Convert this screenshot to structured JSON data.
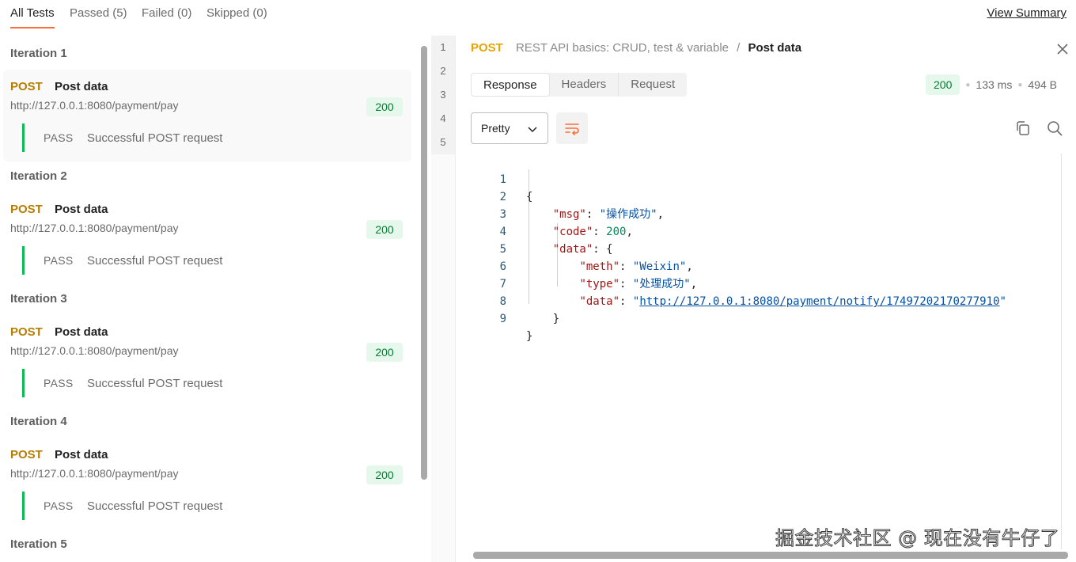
{
  "top_tabs": [
    {
      "label": "All Tests"
    },
    {
      "label": "Passed (5)"
    },
    {
      "label": "Failed (0)"
    },
    {
      "label": "Skipped (0)"
    }
  ],
  "view_summary": "View Summary",
  "iterations": [
    {
      "title": "Iteration 1",
      "method": "POST",
      "name": "Post data",
      "url": "http://127.0.0.1:8080/payment/pay",
      "status": "200",
      "test_result": "PASS",
      "test_name": "Successful POST request"
    },
    {
      "title": "Iteration 2",
      "method": "POST",
      "name": "Post data",
      "url": "http://127.0.0.1:8080/payment/pay",
      "status": "200",
      "test_result": "PASS",
      "test_name": "Successful POST request"
    },
    {
      "title": "Iteration 3",
      "method": "POST",
      "name": "Post data",
      "url": "http://127.0.0.1:8080/payment/pay",
      "status": "200",
      "test_result": "PASS",
      "test_name": "Successful POST request"
    },
    {
      "title": "Iteration 4",
      "method": "POST",
      "name": "Post data",
      "url": "http://127.0.0.1:8080/payment/pay",
      "status": "200",
      "test_result": "PASS",
      "test_name": "Successful POST request"
    },
    {
      "title": "Iteration 5"
    }
  ],
  "iteration_numbers": [
    "1",
    "2",
    "3",
    "4",
    "5"
  ],
  "breadcrumb": {
    "method": "POST",
    "collection": "REST API basics: CRUD, test & variable",
    "separator": "/",
    "request": "Post data"
  },
  "response_tabs": [
    {
      "label": "Response"
    },
    {
      "label": "Headers"
    },
    {
      "label": "Request"
    }
  ],
  "response_meta": {
    "status": "200",
    "time": "133 ms",
    "size": "494 B"
  },
  "format": "Pretty",
  "code": {
    "line_numbers": [
      "1",
      "2",
      "3",
      "4",
      "5",
      "6",
      "7",
      "8",
      "9"
    ],
    "open_brace": "{",
    "close_brace": "}",
    "msg_key": "\"msg\"",
    "msg_value": "\"操作成功\"",
    "code_key": "\"code\"",
    "code_value": "200",
    "data_key": "\"data\"",
    "meth_key": "\"meth\"",
    "meth_value": "\"Weixin\"",
    "type_key": "\"type\"",
    "type_value": "\"处理成功\"",
    "inner_data_key": "\"data\"",
    "inner_data_url": "http://127.0.0.1:8080/payment/notify/17497202170277910"
  },
  "watermark": "掘金技术社区 @ 现在没有牛仔了",
  "colors": {
    "method": "#b77d00",
    "pass_bar": "#0cbb52",
    "status_bg": "#e6f7ec",
    "status_text": "#007f31",
    "accent": "#ff6c37"
  }
}
